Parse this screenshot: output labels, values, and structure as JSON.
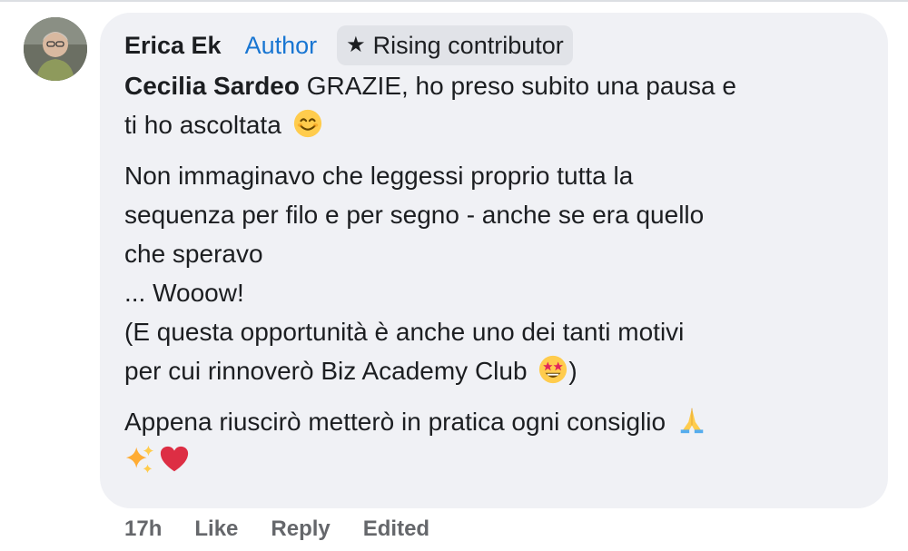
{
  "comment": {
    "author": "Erica Ek",
    "author_label": "Author",
    "badge": {
      "icon": "star-icon",
      "label": "Rising contributor"
    },
    "mention": "Cecilia Sardeo",
    "para1_text": " GRAZIE, ho preso subito una pausa e",
    "para1_line2": "ti ho ascoltata",
    "para2_line1": "Non immaginavo che leggessi proprio tutta la",
    "para2_line2": "sequenza per filo e per segno - anche se era quello",
    "para2_line3": "che speravo",
    "para2_line4": "... Wooow!",
    "para2_line5": "(E questa opportunità è anche uno dei tanti motivi",
    "para2_line6a": "per cui rinnoverò Biz Academy Club",
    "para2_line6b": ")",
    "para3_line1": "Appena riuscirò metterò in pratica ogni consiglio",
    "emojis": [
      "smiling-face-emoji",
      "star-struck-emoji",
      "folded-hands-emoji",
      "sparkles-emoji",
      "red-heart-emoji"
    ]
  },
  "footer": {
    "time": "17h",
    "like": "Like",
    "reply": "Reply",
    "edited": "Edited"
  },
  "colors": {
    "bubble": "#f0f1f5",
    "author_label": "#1976d2",
    "text": "#1c1e21",
    "meta": "#65676b"
  }
}
